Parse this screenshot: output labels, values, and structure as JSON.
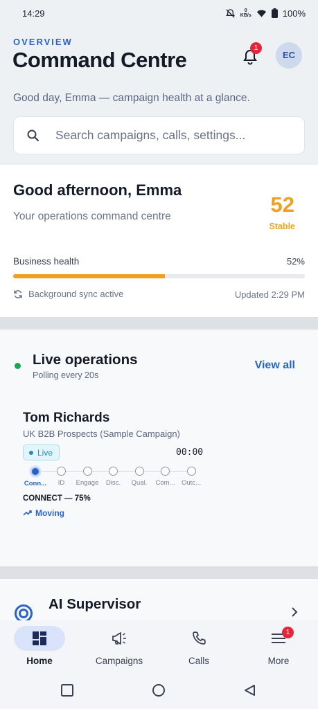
{
  "status_bar": {
    "time": "14:29",
    "kbs_value": "0",
    "kbs_unit": "KB/s",
    "battery": "100%"
  },
  "header": {
    "overline": "OVERVIEW",
    "title": "Command Centre",
    "notification_count": "1",
    "avatar_initials": "EC",
    "subtitle": "Good day, Emma — campaign health at a glance."
  },
  "search": {
    "placeholder": "Search campaigns, calls, settings..."
  },
  "health": {
    "greeting": "Good afternoon, Emma",
    "subtitle": "Your operations command centre",
    "score": "52",
    "score_label": "Stable",
    "bar_label": "Business health",
    "bar_percent_text": "52%",
    "bar_value": 0.52,
    "sync_text": "Background sync active",
    "updated_text": "Updated 2:29 PM"
  },
  "live": {
    "title": "Live operations",
    "polling": "Polling every 20s",
    "view_all": "View all",
    "call": {
      "name": "Tom Richards",
      "campaign": "UK B2B Prospects (Sample Campaign)",
      "status": "Live",
      "timer": "00:00",
      "stages": [
        "Conn...",
        "ID",
        "Engage",
        "Disc.",
        "Qual.",
        "Com...",
        "Outc..."
      ],
      "active_stage": 0,
      "stage_progress": "CONNECT — 75%",
      "trend": "Moving"
    }
  },
  "ai_supervisor": {
    "title": "AI Supervisor"
  },
  "bottom_nav": {
    "home": "Home",
    "campaigns": "Campaigns",
    "calls": "Calls",
    "more": "More",
    "more_badge": "1"
  },
  "colors": {
    "accent": "#2a63c8",
    "warning": "#f0a020",
    "live_green": "#1ba35a",
    "badge_red": "#e3263a"
  }
}
